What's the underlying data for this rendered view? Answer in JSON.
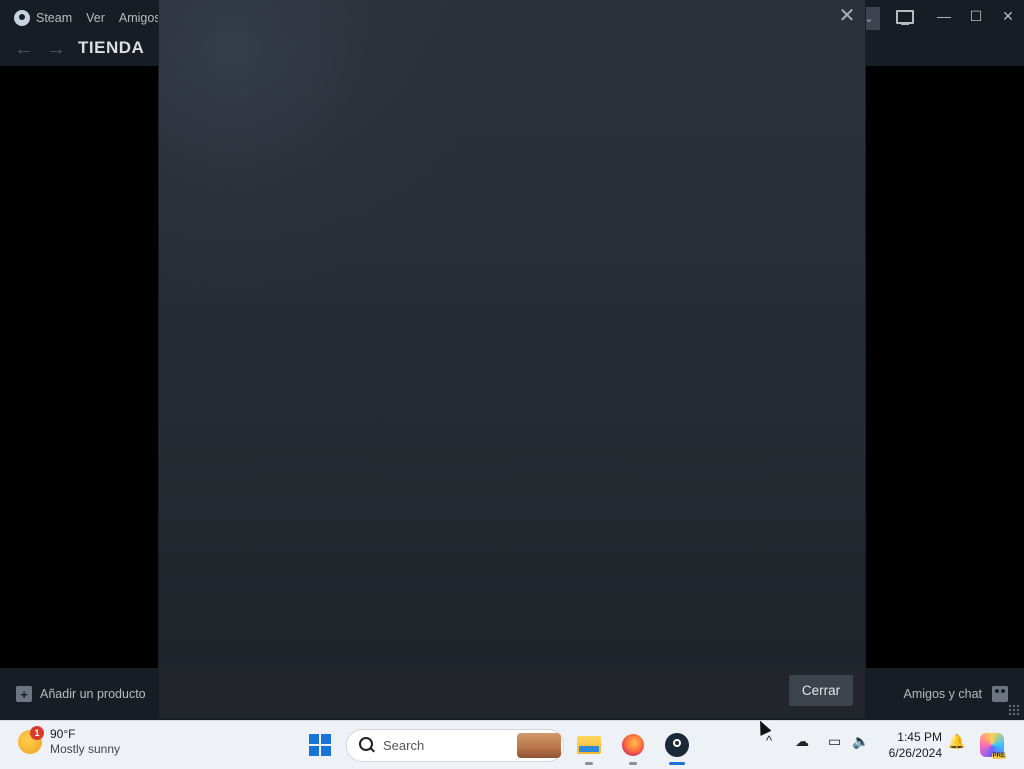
{
  "steam": {
    "menu": [
      "Steam",
      "Ver",
      "Amigos"
    ],
    "store_title": "TIENDA",
    "add_product": "Añadir un producto",
    "friends_chat": "Amigos y chat",
    "controls": {
      "minimize": "—",
      "maximize": "☐",
      "close": "✕"
    }
  },
  "modal": {
    "close_glyph": "✕",
    "close_button": "Cerrar"
  },
  "taskbar": {
    "weather": {
      "temp": "90°F",
      "condition": "Mostly sunny",
      "badge": "1"
    },
    "search_placeholder": "Search",
    "apps": [
      "file-explorer",
      "firefox",
      "steam"
    ],
    "tray": {
      "chevron": "^",
      "time": "1:45 PM",
      "date": "6/26/2024",
      "copilot_badge": "PRE"
    }
  },
  "colors": {
    "steam_bar": "#171d25",
    "modal_bg": "#2b313a",
    "button_bg": "#3d434c",
    "taskbar_bg": "#eef1f6",
    "accent": "#1a73d9"
  }
}
